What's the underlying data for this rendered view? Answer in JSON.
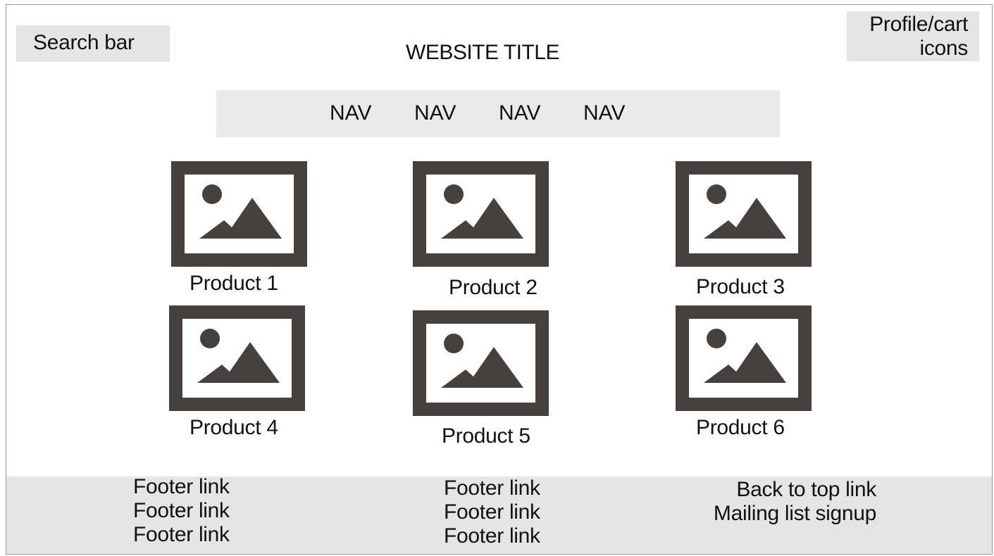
{
  "header": {
    "search_label": "Search bar",
    "title": "WEBSITE TITLE",
    "profile_cart_label": "Profile/cart\nicons"
  },
  "nav": {
    "items": [
      "NAV",
      "NAV",
      "NAV",
      "NAV"
    ]
  },
  "products": [
    {
      "label": "Product 1",
      "icon": "image-placeholder-icon"
    },
    {
      "label": "Product 2",
      "icon": "image-placeholder-icon"
    },
    {
      "label": "Product 3",
      "icon": "image-placeholder-icon"
    },
    {
      "label": "Product 4",
      "icon": "image-placeholder-icon"
    },
    {
      "label": "Product 5",
      "icon": "image-placeholder-icon"
    },
    {
      "label": "Product 6",
      "icon": "image-placeholder-icon"
    }
  ],
  "footer": {
    "columns": [
      [
        "Footer link",
        "Footer link",
        "Footer link"
      ],
      [
        "Footer link",
        "Footer link",
        "Footer link"
      ],
      [
        "Back to top link",
        "Mailing list signup"
      ]
    ]
  },
  "colors": {
    "placeholder_gray": "#e7e5e4",
    "image_icon_dark": "#45413e"
  }
}
